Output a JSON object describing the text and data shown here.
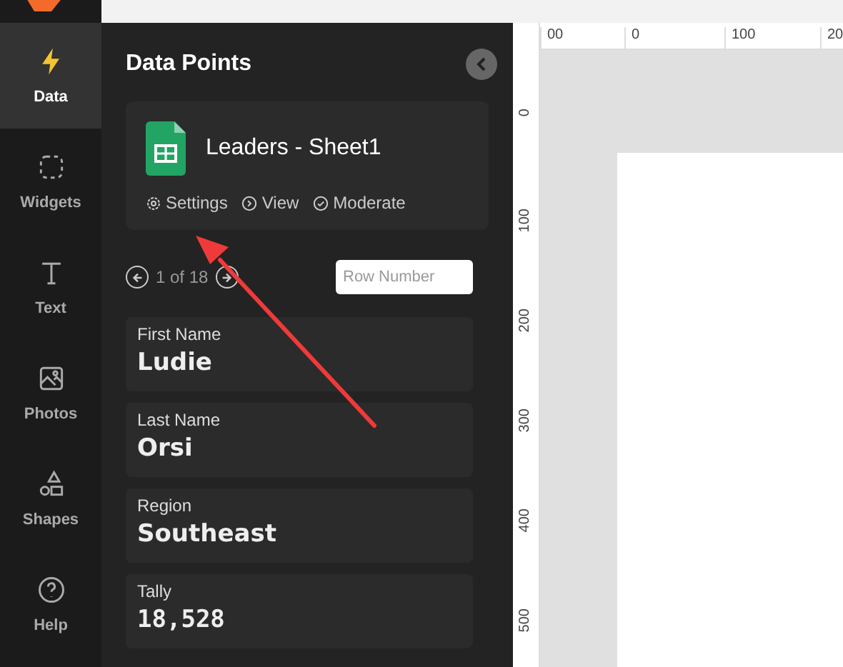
{
  "sidebar": {
    "items": [
      {
        "kind": "bolt",
        "label": "Data",
        "selected": true
      },
      {
        "kind": "widgets",
        "label": "Widgets",
        "selected": false
      },
      {
        "kind": "text",
        "label": "Text",
        "selected": false
      },
      {
        "kind": "photos",
        "label": "Photos",
        "selected": false
      },
      {
        "kind": "shapes",
        "label": "Shapes",
        "selected": false
      },
      {
        "kind": "help",
        "label": "Help",
        "selected": false
      }
    ]
  },
  "panel": {
    "title": "Data Points",
    "source": {
      "name": "Leaders - Sheet1",
      "actions": [
        {
          "kind": "settings",
          "label": "Settings"
        },
        {
          "kind": "view",
          "label": "View"
        },
        {
          "kind": "moderate",
          "label": "Moderate"
        }
      ]
    },
    "pager": {
      "position": "1 of 18",
      "row_input": {
        "placeholder": "Row Number"
      }
    },
    "fields": [
      {
        "label": "First Name",
        "value": "Ludie",
        "kind": "text"
      },
      {
        "label": "Last Name",
        "value": "Orsi",
        "kind": "text"
      },
      {
        "label": "Region",
        "value": "Southeast",
        "kind": "text"
      },
      {
        "label": "Tally",
        "value": "18,528",
        "kind": "number"
      }
    ]
  },
  "rulers": {
    "horizontal": [
      "00",
      "0",
      "100",
      "20"
    ],
    "vertical": [
      "0",
      "100",
      "200",
      "300",
      "400",
      "500"
    ]
  }
}
